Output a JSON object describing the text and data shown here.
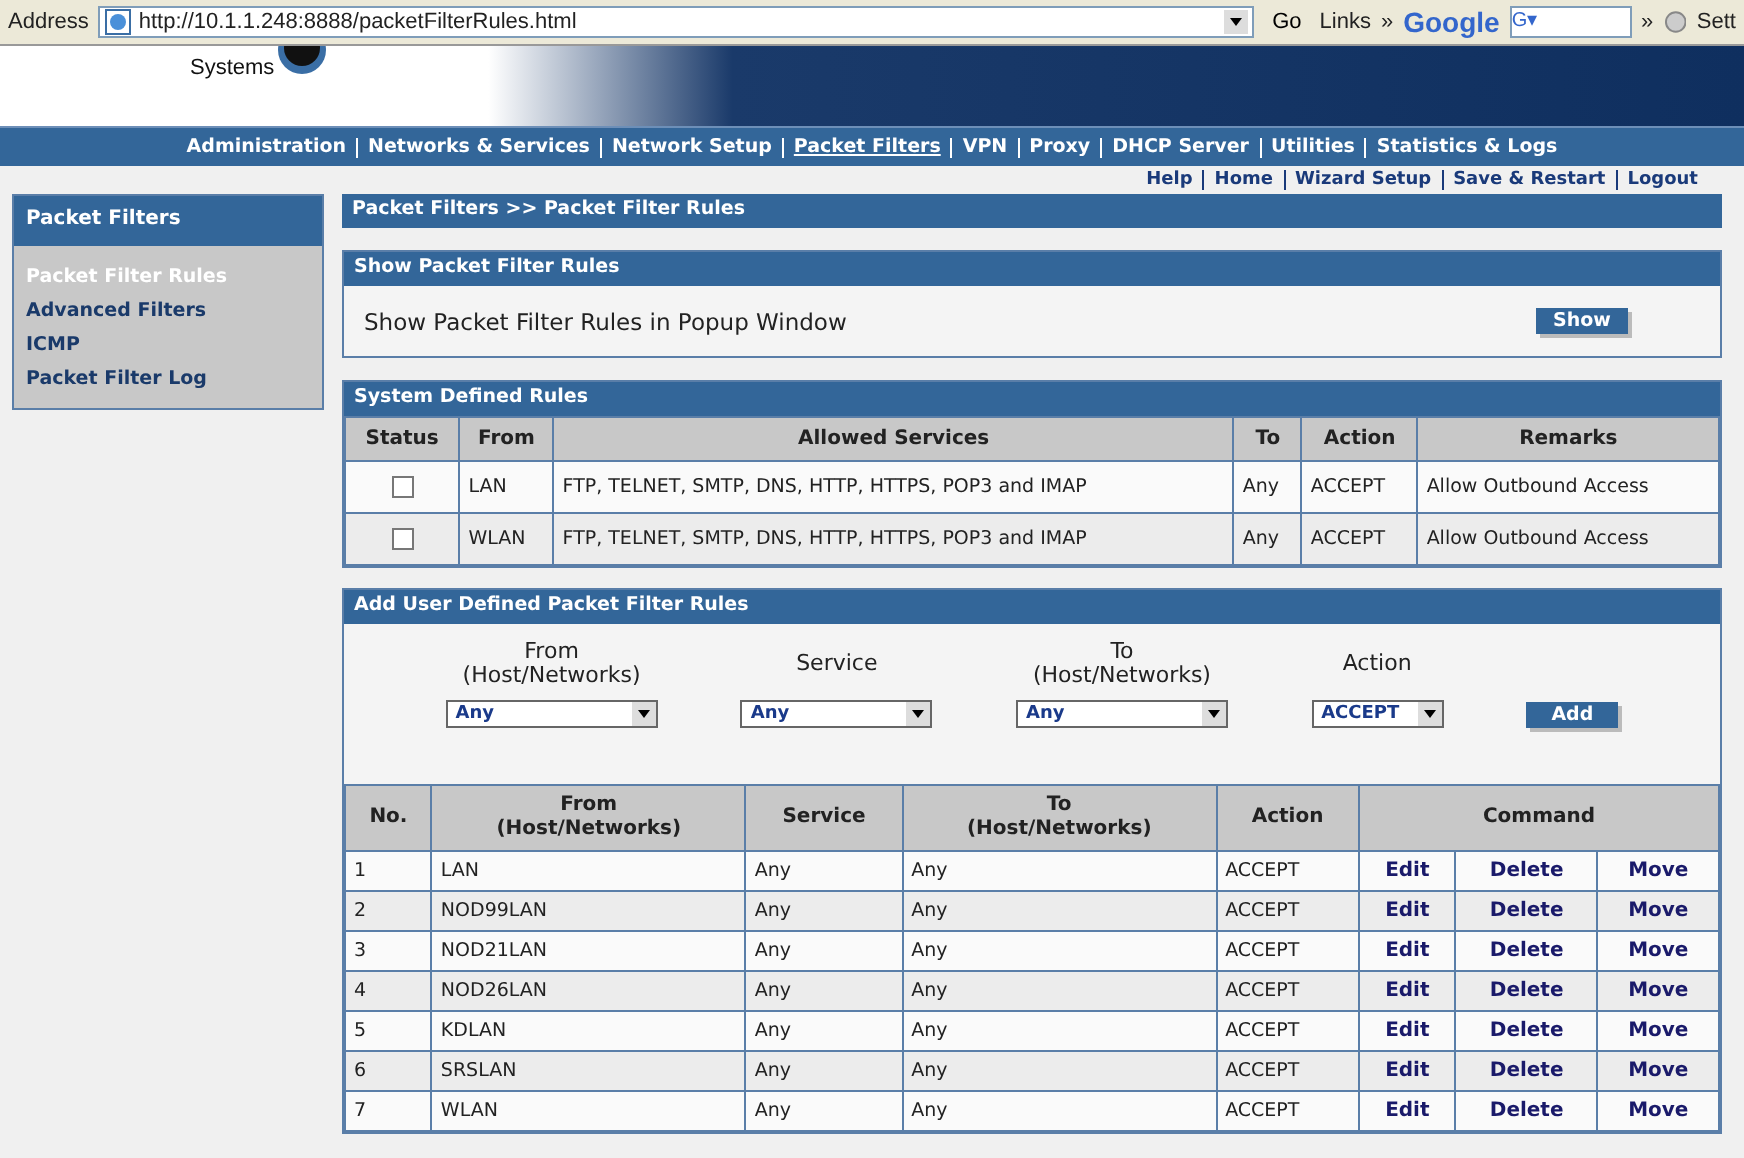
{
  "browser": {
    "address_label": "Address",
    "url": "http://10.1.1.248:8888/packetFilterRules.html",
    "go": "Go",
    "links": "Links",
    "chevron": "»",
    "search_brand": "Google",
    "search_value": "G▾",
    "chevron2": "»",
    "settings": "Sett"
  },
  "logo": {
    "subtitle": "Systems"
  },
  "nav": [
    {
      "label": "Administration",
      "selected": false
    },
    {
      "label": "Networks & Services",
      "selected": false
    },
    {
      "label": "Network Setup",
      "selected": false
    },
    {
      "label": "Packet Filters",
      "selected": true
    },
    {
      "label": "VPN",
      "selected": false
    },
    {
      "label": "Proxy",
      "selected": false
    },
    {
      "label": "DHCP Server",
      "selected": false
    },
    {
      "label": "Utilities",
      "selected": false
    },
    {
      "label": "Statistics & Logs",
      "selected": false
    }
  ],
  "top_links": [
    "Help",
    "Home",
    "Wizard Setup",
    "Save & Restart",
    "Logout"
  ],
  "sidebar": {
    "title": "Packet Filters",
    "items": [
      {
        "label": "Packet Filter Rules",
        "selected": true
      },
      {
        "label": "Advanced Filters",
        "selected": false
      },
      {
        "label": "ICMP",
        "selected": false
      },
      {
        "label": "Packet Filter Log",
        "selected": false
      }
    ]
  },
  "breadcrumb": "Packet Filters  >>  Packet Filter Rules",
  "show_section": {
    "title": "Show Packet Filter Rules",
    "text": "Show Packet Filter Rules in Popup Window",
    "button": "Show"
  },
  "system_rules": {
    "title": "System Defined Rules",
    "columns": [
      "Status",
      "From",
      "Allowed Services",
      "To",
      "Action",
      "Remarks"
    ],
    "rows": [
      {
        "checked": false,
        "from": "LAN",
        "services": "FTP, TELNET, SMTP, DNS, HTTP, HTTPS, POP3 and IMAP",
        "to": "Any",
        "action": "ACCEPT",
        "remarks": "Allow Outbound Access"
      },
      {
        "checked": false,
        "from": "WLAN",
        "services": "FTP, TELNET, SMTP, DNS, HTTP, HTTPS, POP3 and IMAP",
        "to": "Any",
        "action": "ACCEPT",
        "remarks": "Allow Outbound Access"
      }
    ]
  },
  "add_rule": {
    "title": "Add User Defined Packet Filter Rules",
    "fields": [
      {
        "label": "From\n(Host/Networks)",
        "value": "Any"
      },
      {
        "label": "Service",
        "value": "Any"
      },
      {
        "label": "To\n(Host/Networks)",
        "value": "Any"
      },
      {
        "label": "Action",
        "value": "ACCEPT"
      }
    ],
    "button": "Add"
  },
  "user_rules": {
    "columns": [
      "No.",
      "From\n(Host/Networks)",
      "Service",
      "To\n(Host/Networks)",
      "Action",
      "Command"
    ],
    "rows": [
      {
        "no": "1",
        "from": "LAN",
        "service": "Any",
        "to": "Any",
        "action": "ACCEPT",
        "commands": [
          "Edit",
          "Delete",
          "Move"
        ]
      },
      {
        "no": "2",
        "from": "NOD99LAN",
        "service": "Any",
        "to": "Any",
        "action": "ACCEPT",
        "commands": [
          "Edit",
          "Delete",
          "Move"
        ]
      },
      {
        "no": "3",
        "from": "NOD21LAN",
        "service": "Any",
        "to": "Any",
        "action": "ACCEPT",
        "commands": [
          "Edit",
          "Delete",
          "Move"
        ]
      },
      {
        "no": "4",
        "from": "NOD26LAN",
        "service": "Any",
        "to": "Any",
        "action": "ACCEPT",
        "commands": [
          "Edit",
          "Delete",
          "Move"
        ]
      },
      {
        "no": "5",
        "from": "KDLAN",
        "service": "Any",
        "to": "Any",
        "action": "ACCEPT",
        "commands": [
          "Edit",
          "Delete",
          "Move"
        ]
      },
      {
        "no": "6",
        "from": "SRSLAN",
        "service": "Any",
        "to": "Any",
        "action": "ACCEPT",
        "commands": [
          "Edit",
          "Delete",
          "Move"
        ]
      },
      {
        "no": "7",
        "from": "WLAN",
        "service": "Any",
        "to": "Any",
        "action": "ACCEPT",
        "commands": [
          "Edit",
          "Delete",
          "Move"
        ]
      }
    ]
  }
}
